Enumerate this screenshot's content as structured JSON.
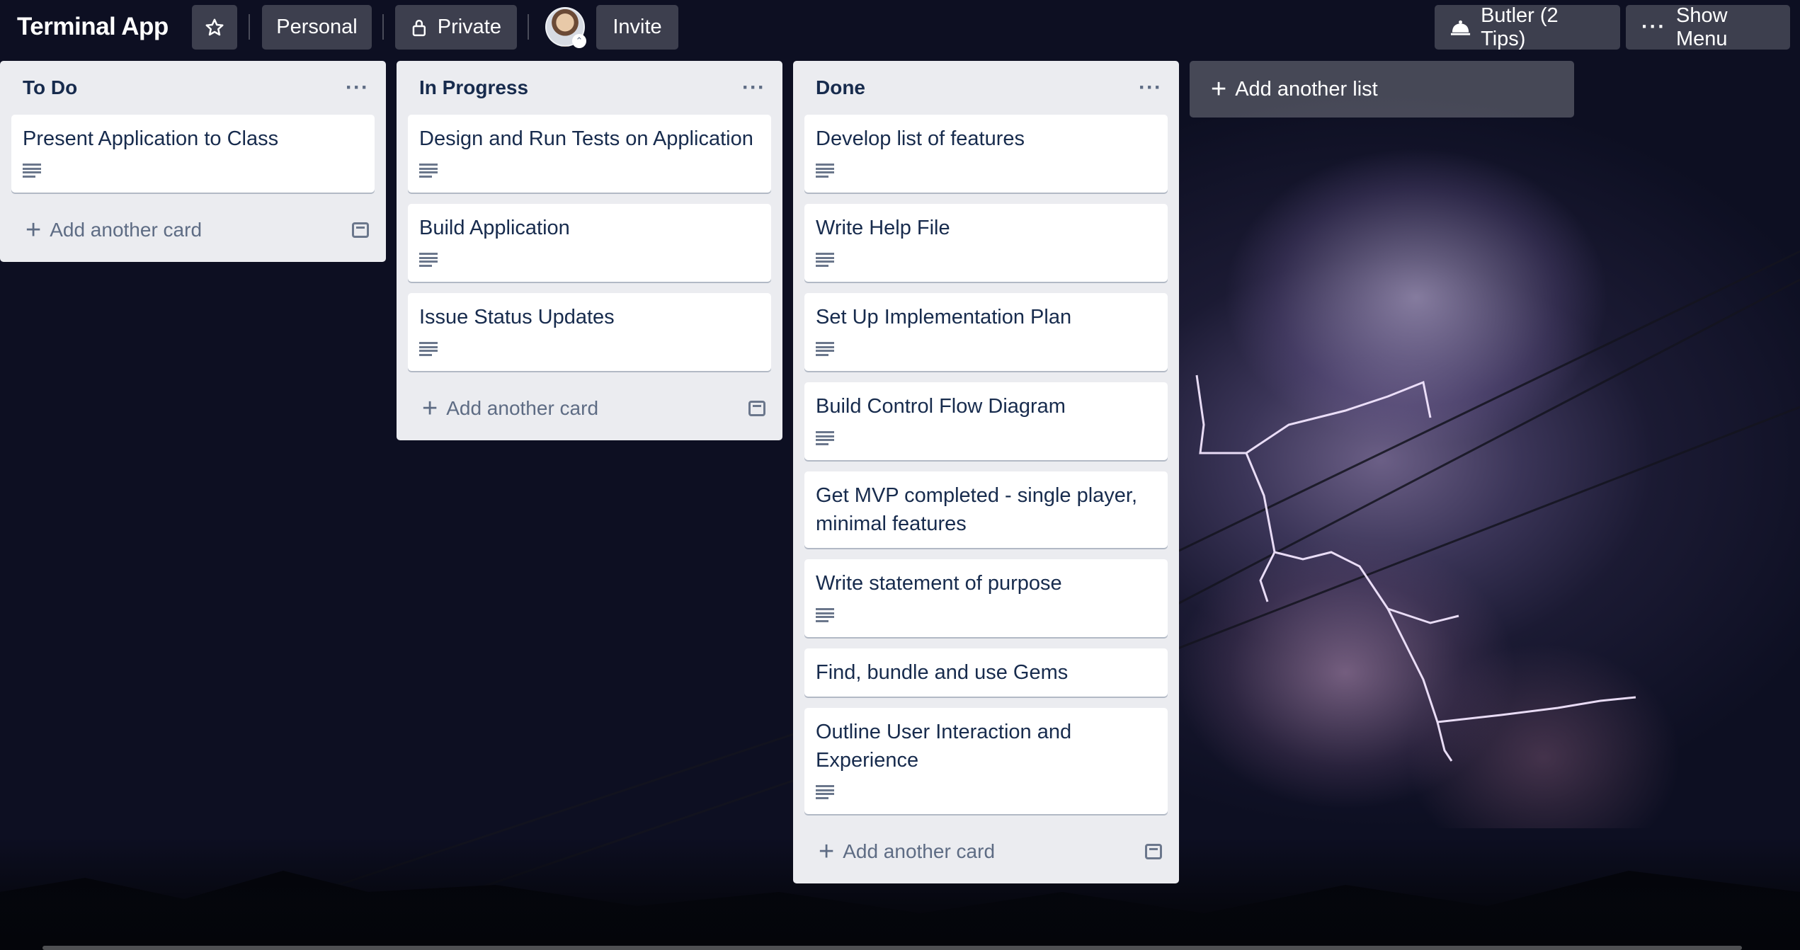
{
  "board": {
    "title": "Terminal App",
    "visibility_team": "Personal",
    "visibility": "Private",
    "invite_label": "Invite",
    "butler_label": "Butler (2 Tips)",
    "show_menu_label": "Show Menu"
  },
  "lists": [
    {
      "title": "To Do",
      "cards": [
        {
          "title": "Present Application to Class",
          "has_description": true
        }
      ],
      "add_card_label": "Add another card"
    },
    {
      "title": "In Progress",
      "cards": [
        {
          "title": "Design and Run Tests on Application",
          "has_description": true
        },
        {
          "title": "Build Application",
          "has_description": true
        },
        {
          "title": "Issue Status Updates",
          "has_description": true
        }
      ],
      "add_card_label": "Add another card"
    },
    {
      "title": "Done",
      "cards": [
        {
          "title": "Develop list of features",
          "has_description": true
        },
        {
          "title": "Write Help File",
          "has_description": true
        },
        {
          "title": "Set Up Implementation Plan",
          "has_description": true
        },
        {
          "title": "Build Control Flow Diagram",
          "has_description": true
        },
        {
          "title": "Get MVP completed - single player, minimal features",
          "has_description": false
        },
        {
          "title": "Write statement of purpose",
          "has_description": true
        },
        {
          "title": "Find, bundle and use Gems",
          "has_description": false
        },
        {
          "title": "Outline User Interaction and Experience",
          "has_description": true
        }
      ],
      "add_card_label": "Add another card"
    }
  ],
  "add_list_label": "Add another list",
  "icons": {
    "star": "star-icon",
    "lock": "lock-icon",
    "butler": "bell-icon",
    "menu": "more-icon",
    "description": "description-icon",
    "template": "card-template-icon"
  }
}
